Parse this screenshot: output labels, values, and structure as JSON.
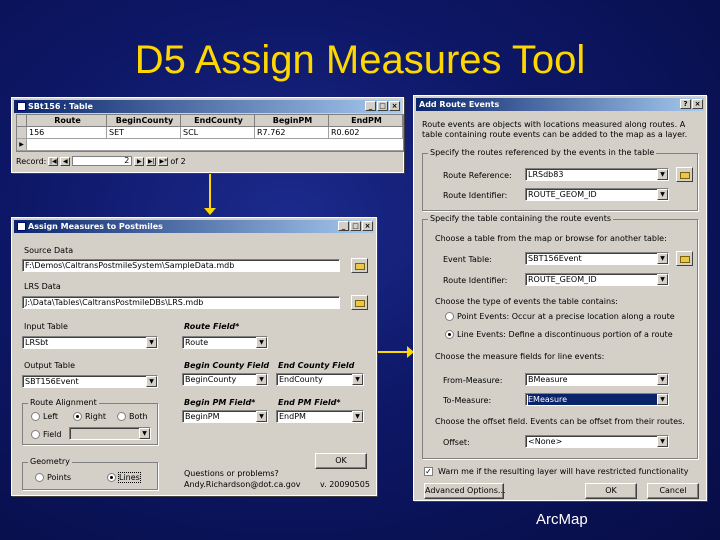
{
  "slide": {
    "title": "D5 Assign Measures Tool",
    "footer": "ArcMap",
    "accent_color": "#ffd700"
  },
  "table_window": {
    "title": "SBt156 : Table",
    "columns": [
      "Route",
      "BeginCounty",
      "EndCounty",
      "BeginPM",
      "EndPM"
    ],
    "rows": [
      [
        "156",
        "SET",
        "SCL",
        "R7.762",
        "R0.602"
      ]
    ],
    "record_label": "Record:",
    "record_value": "2",
    "of_label": "of 2"
  },
  "assign_window": {
    "title": "Assign Measures to Postmiles",
    "source_data_label": "Source Data",
    "source_data_value": "F:\\Demos\\CaltransPostmileSystem\\SampleData.mdb",
    "lrs_data_label": "LRS Data",
    "lrs_data_value": "J:\\Data\\Tables\\CaltransPostmileDBs\\LRS.mdb",
    "input_table_label": "Input Table",
    "input_table_value": "LRSbt",
    "route_field_label": "Route Field*",
    "route_field_value": "Route",
    "output_table_label": "Output Table",
    "output_table_value": "SBT156Event",
    "begin_county_label": "Begin County Field",
    "begin_county_value": "BeginCounty",
    "end_county_label": "End County Field",
    "end_county_value": "EndCounty",
    "route_alignment_label": "Route Alignment",
    "align_left": "Left",
    "align_right": "Right",
    "align_both": "Both",
    "align_field": "Field",
    "begin_pm_label": "Begin PM Field*",
    "begin_pm_value": "BeginPM",
    "end_pm_label": "End PM Field*",
    "end_pm_value": "EndPM",
    "ok_label": "OK",
    "geometry_label": "Geometry",
    "geom_points": "Points",
    "geom_lines": "Lines",
    "questions_label": "Questions or problems?",
    "contact_label": "Andy.Richardson@dot.ca.gov",
    "version_label": "v. 20090505"
  },
  "route_events_window": {
    "title": "Add Route Events",
    "intro_text": "Route events are objects with locations measured along routes. A table containing route events can be added to the map as a layer.",
    "routes_group": "Specify the routes referenced by the events in the table",
    "route_reference_label": "Route Reference:",
    "route_reference_value": "LRSdb83",
    "route_identifier_label": "Route Identifier:",
    "route_identifier_value": "ROUTE_GEOM_ID",
    "events_group": "Specify the table containing the route events",
    "choose_table_text": "Choose a table from the map or browse for another table:",
    "event_table_label": "Event Table:",
    "event_table_value": "SBT156Event",
    "event_route_id_label": "Route Identifier:",
    "event_route_id_value": "ROUTE_GEOM_ID",
    "event_type_text": "Choose the type of events the table contains:",
    "point_events": "Point Events: Occur at a precise location along a route",
    "line_events": "Line Events: Define a discontinuous portion of a route",
    "measure_fields_text": "Choose the measure fields for line events:",
    "from_measure_label": "From-Measure:",
    "from_measure_value": "BMeasure",
    "to_measure_label": "To-Measure:",
    "to_measure_value": "EMeasure",
    "offset_text": "Choose the offset field. Events can be offset from their routes.",
    "offset_label": "Offset:",
    "offset_value": "<None>",
    "warn_label": "Warn me if the resulting layer will have restricted functionality",
    "advanced_label": "Advanced Options...",
    "ok_label": "OK",
    "cancel_label": "Cancel"
  }
}
